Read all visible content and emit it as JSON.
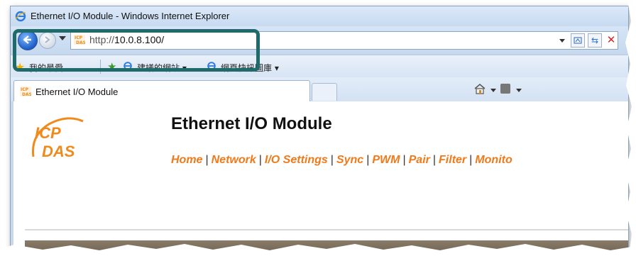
{
  "window": {
    "title": "Ethernet I/O Module - Windows Internet Explorer"
  },
  "navbar": {
    "url_proto": "http://",
    "url_host": "10.0.8.100/"
  },
  "favorites_bar": {
    "favorites_label": "我的最愛",
    "suggested_label": "建議的網站 ▾",
    "web_slices_label": "網頁快訊圖庫 ▾"
  },
  "tabs": [
    {
      "label": "Ethernet I/O Module"
    }
  ],
  "page": {
    "logo_text_top": "ICP",
    "logo_text_bottom": "DAS",
    "title": "Ethernet I/O Module",
    "nav_links": [
      "Home",
      "Network",
      "I/O Settings",
      "Sync",
      "PWM",
      "Pair",
      "Filter",
      "Monito"
    ]
  },
  "colors": {
    "nav_link": "#f07a1a",
    "highlight_box": "#1f6b6b",
    "logo_orange": "#f08a1c"
  }
}
